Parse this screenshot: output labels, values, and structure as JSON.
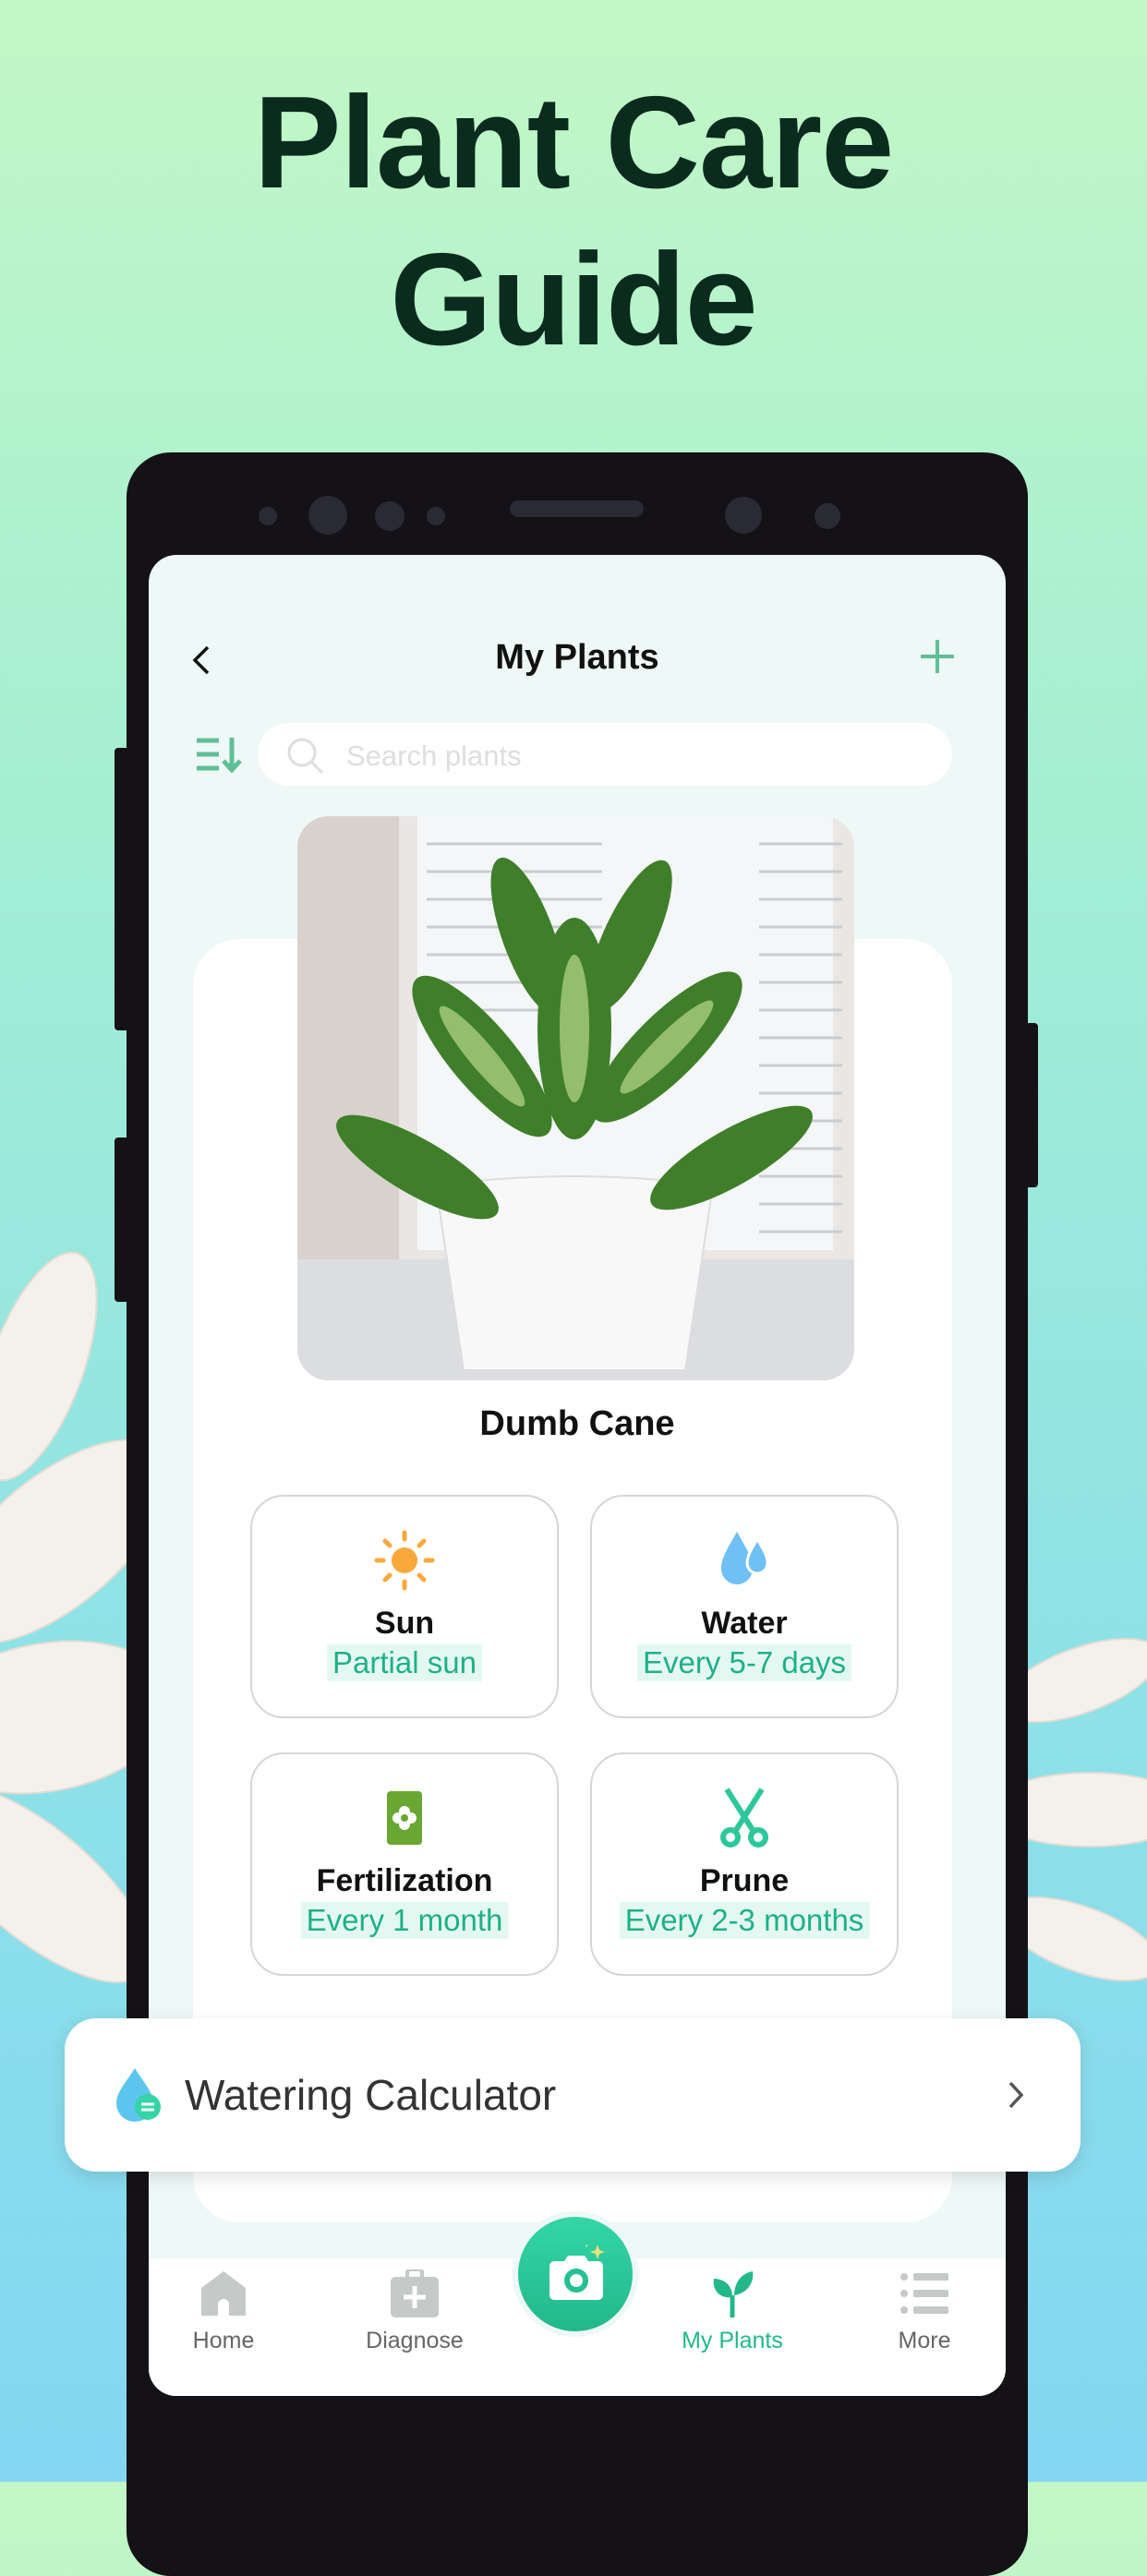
{
  "headline": {
    "line1": "Plant Care",
    "line2": "Guide"
  },
  "header": {
    "title": "My Plants",
    "back_icon": "chevron-left-icon",
    "add_icon": "plus-icon"
  },
  "search": {
    "placeholder": "Search plants",
    "sort_icon": "sort-icon"
  },
  "plant": {
    "name": "Dumb Cane",
    "care": [
      {
        "title": "Sun",
        "value": "Partial sun",
        "icon": "sun-icon"
      },
      {
        "title": "Water",
        "value": "Every 5-7 days",
        "icon": "water-drops-icon"
      },
      {
        "title": "Fertilization",
        "value": "Every 1 month",
        "icon": "fertilizer-bag-icon"
      },
      {
        "title": "Prune",
        "value": "Every 2-3 months",
        "icon": "scissors-icon"
      }
    ]
  },
  "watering_calculator": {
    "label": "Watering Calculator"
  },
  "tabbar": {
    "items": [
      {
        "label": "Home",
        "active": false
      },
      {
        "label": "Diagnose",
        "active": false
      },
      {
        "label": "My Plants",
        "active": true
      },
      {
        "label": "More",
        "active": false
      }
    ]
  },
  "colors": {
    "accent": "#22b88a",
    "title": "#0b2b1e",
    "inactive": "#c5c9c8"
  }
}
